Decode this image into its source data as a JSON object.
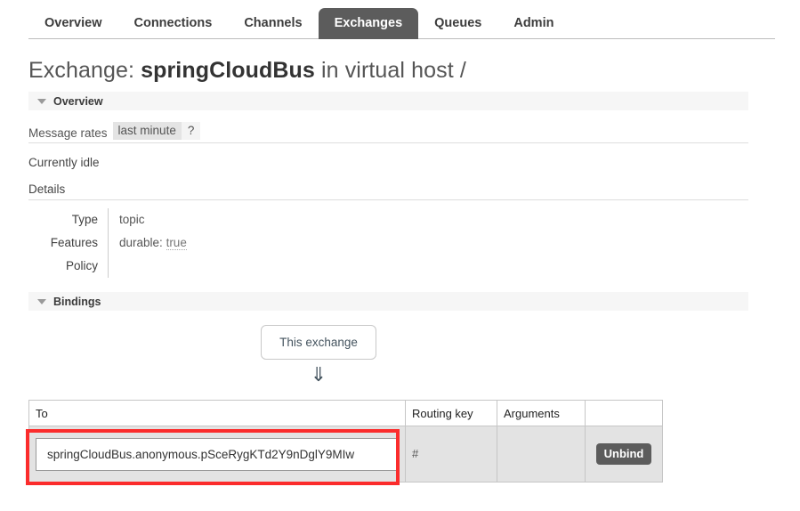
{
  "nav": {
    "tabs": [
      {
        "label": "Overview",
        "active": false
      },
      {
        "label": "Connections",
        "active": false
      },
      {
        "label": "Channels",
        "active": false
      },
      {
        "label": "Exchanges",
        "active": true
      },
      {
        "label": "Queues",
        "active": false
      },
      {
        "label": "Admin",
        "active": false
      }
    ]
  },
  "page": {
    "title_prefix": "Exchange:",
    "exchange_name": "springCloudBus",
    "title_middle": "in virtual host",
    "vhost": "/"
  },
  "overview": {
    "section_label": "Overview",
    "message_rates_label": "Message rates",
    "rate_period": "last minute",
    "help": "?",
    "idle_text": "Currently idle",
    "details_label": "Details",
    "details": [
      {
        "key": "Type",
        "value": "topic",
        "value_suffix": ""
      },
      {
        "key": "Features",
        "value": "durable:",
        "value_suffix": "true"
      },
      {
        "key": "Policy",
        "value": "",
        "value_suffix": ""
      }
    ]
  },
  "bindings": {
    "section_label": "Bindings",
    "this_exchange_label": "This exchange",
    "arrow_icon": "⇓",
    "columns": [
      "To",
      "Routing key",
      "Arguments",
      ""
    ],
    "rows": [
      {
        "to": "springCloudBus.anonymous.pSceRygKTd2Y9nDglY9MIw",
        "routing_key": "#",
        "arguments": "",
        "action_label": "Unbind"
      }
    ]
  },
  "colors": {
    "active_tab_bg": "#5c5c5c",
    "annotation": "#fb2c2c",
    "section_band": "#f6f6f6",
    "row_bg": "#e3e3e3"
  }
}
